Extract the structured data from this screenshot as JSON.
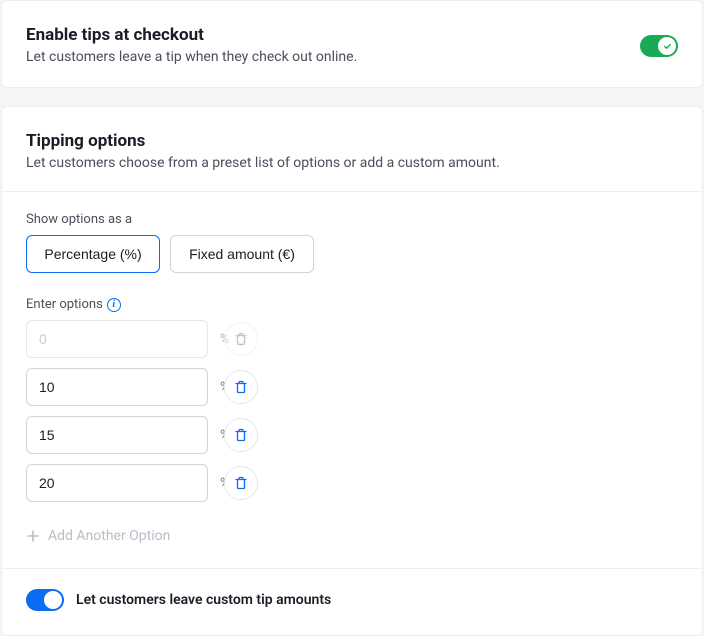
{
  "enable": {
    "title": "Enable tips at checkout",
    "subtitle": "Let customers leave a tip when they check out online.",
    "toggled": true
  },
  "tipping": {
    "title": "Tipping options",
    "subtitle": "Let customers choose from a preset list of options or add a custom amount.",
    "show_as_label": "Show options as a",
    "seg_percentage": "Percentage (%)",
    "seg_fixed": "Fixed amount (€)",
    "enter_label": "Enter options",
    "unit": "%",
    "options": [
      {
        "value": "0",
        "disabled": true
      },
      {
        "value": "10",
        "disabled": false
      },
      {
        "value": "15",
        "disabled": false
      },
      {
        "value": "20",
        "disabled": false
      }
    ],
    "add_label": "Add Another Option",
    "custom_label": "Let customers leave custom tip amounts",
    "custom_toggled": true
  }
}
